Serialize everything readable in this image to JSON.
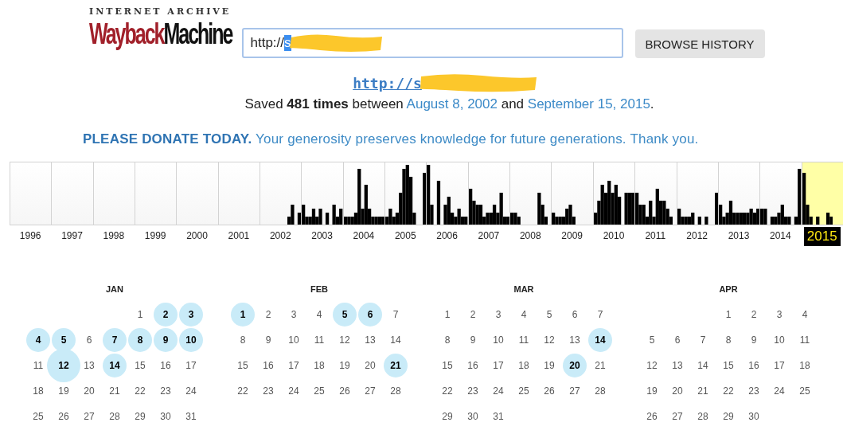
{
  "logo": {
    "top": "INTERNET ARCHIVE",
    "wayback": "Wayback",
    "machine": "Machine"
  },
  "search": {
    "value": "http://",
    "selected_text": "s"
  },
  "browse_button": "BROWSE HISTORY",
  "site_link": "http://s",
  "summary": [
    {
      "kind": "text",
      "text": "Saved **481 times** between "
    },
    {
      "kind": "link",
      "text": "August 8, 2002"
    },
    {
      "kind": "text",
      "text": " and "
    },
    {
      "kind": "link",
      "text": "September 15, 2015"
    },
    {
      "kind": "text",
      "text": "."
    }
  ],
  "donate": "**PLEASE DONATE TODAY.** Your generosity preserves knowledge for future generations. Thank you.",
  "years": [
    {
      "label": "1996",
      "selected": false
    },
    {
      "label": "1997",
      "selected": false
    },
    {
      "label": "1998",
      "selected": false
    },
    {
      "label": "1999",
      "selected": false
    },
    {
      "label": "2000",
      "selected": false
    },
    {
      "label": "2001",
      "selected": false
    },
    {
      "label": "2002",
      "selected": false
    },
    {
      "label": "2003",
      "selected": false
    },
    {
      "label": "2004",
      "selected": false
    },
    {
      "label": "2005",
      "selected": false
    },
    {
      "label": "2006",
      "selected": false
    },
    {
      "label": "2007",
      "selected": false
    },
    {
      "label": "2008",
      "selected": false
    },
    {
      "label": "2009",
      "selected": false
    },
    {
      "label": "2010",
      "selected": false
    },
    {
      "label": "2011",
      "selected": false
    },
    {
      "label": "2012",
      "selected": false
    },
    {
      "label": "2013",
      "selected": false
    },
    {
      "label": "2014",
      "selected": false
    },
    {
      "label": "2015",
      "selected": true
    }
  ],
  "months": [
    {
      "name": "JAN",
      "weeks": [
        {
          "days": [
            {
              "day": "1",
              "captured": false
            },
            {
              "day": "2",
              "captured": true
            },
            {
              "day": "3",
              "captured": true
            }
          ]
        },
        {
          "days": [
            {
              "day": "4",
              "captured": true
            },
            {
              "day": "5",
              "captured": true
            },
            {
              "day": "6",
              "captured": false
            },
            {
              "day": "7",
              "captured": true
            },
            {
              "day": "8",
              "captured": true
            },
            {
              "day": "9",
              "captured": true
            },
            {
              "day": "10",
              "captured": true
            }
          ]
        },
        {
          "days": [
            {
              "day": "11",
              "captured": false
            },
            {
              "day": "12",
              "captured": true,
              "large": true
            },
            {
              "day": "13",
              "captured": false
            },
            {
              "day": "14",
              "captured": true
            },
            {
              "day": "15",
              "captured": false
            },
            {
              "day": "16",
              "captured": false
            },
            {
              "day": "17",
              "captured": false
            }
          ]
        },
        {
          "days": [
            {
              "day": "18",
              "captured": false
            },
            {
              "day": "19",
              "captured": false
            },
            {
              "day": "20",
              "captured": false
            },
            {
              "day": "21",
              "captured": false
            },
            {
              "day": "22",
              "captured": false
            },
            {
              "day": "23",
              "captured": false
            },
            {
              "day": "24",
              "captured": false
            }
          ]
        },
        {
          "days": [
            {
              "day": "25",
              "captured": false
            },
            {
              "day": "26",
              "captured": false
            },
            {
              "day": "27",
              "captured": false
            },
            {
              "day": "28",
              "captured": false
            },
            {
              "day": "29",
              "captured": false
            },
            {
              "day": "30",
              "captured": false
            },
            {
              "day": "31",
              "captured": false
            }
          ]
        }
      ]
    },
    {
      "name": "FEB",
      "weeks": [
        {
          "days": [
            {
              "day": "1",
              "captured": true
            },
            {
              "day": "2",
              "captured": false
            },
            {
              "day": "3",
              "captured": false
            },
            {
              "day": "4",
              "captured": false
            },
            {
              "day": "5",
              "captured": true
            },
            {
              "day": "6",
              "captured": true
            },
            {
              "day": "7",
              "captured": false
            }
          ]
        },
        {
          "days": [
            {
              "day": "8",
              "captured": false
            },
            {
              "day": "9",
              "captured": false
            },
            {
              "day": "10",
              "captured": false
            },
            {
              "day": "11",
              "captured": false
            },
            {
              "day": "12",
              "captured": false
            },
            {
              "day": "13",
              "captured": false
            },
            {
              "day": "14",
              "captured": false
            }
          ]
        },
        {
          "days": [
            {
              "day": "15",
              "captured": false
            },
            {
              "day": "16",
              "captured": false
            },
            {
              "day": "17",
              "captured": false
            },
            {
              "day": "18",
              "captured": false
            },
            {
              "day": "19",
              "captured": false
            },
            {
              "day": "20",
              "captured": false
            },
            {
              "day": "21",
              "captured": true
            }
          ]
        },
        {
          "days": [
            {
              "day": "22",
              "captured": false
            },
            {
              "day": "23",
              "captured": false
            },
            {
              "day": "24",
              "captured": false
            },
            {
              "day": "25",
              "captured": false
            },
            {
              "day": "26",
              "captured": false
            },
            {
              "day": "27",
              "captured": false
            },
            {
              "day": "28",
              "captured": false
            }
          ]
        }
      ]
    },
    {
      "name": "MAR",
      "weeks": [
        {
          "days": [
            {
              "day": "1",
              "captured": false
            },
            {
              "day": "2",
              "captured": false
            },
            {
              "day": "3",
              "captured": false
            },
            {
              "day": "4",
              "captured": false
            },
            {
              "day": "5",
              "captured": false
            },
            {
              "day": "6",
              "captured": false
            },
            {
              "day": "7",
              "captured": false
            }
          ]
        },
        {
          "days": [
            {
              "day": "8",
              "captured": false
            },
            {
              "day": "9",
              "captured": false
            },
            {
              "day": "10",
              "captured": false
            },
            {
              "day": "11",
              "captured": false
            },
            {
              "day": "12",
              "captured": false
            },
            {
              "day": "13",
              "captured": false
            },
            {
              "day": "14",
              "captured": true
            }
          ]
        },
        {
          "days": [
            {
              "day": "15",
              "captured": false
            },
            {
              "day": "16",
              "captured": false
            },
            {
              "day": "17",
              "captured": false
            },
            {
              "day": "18",
              "captured": false
            },
            {
              "day": "19",
              "captured": false
            },
            {
              "day": "20",
              "captured": true
            },
            {
              "day": "21",
              "captured": false
            }
          ]
        },
        {
          "days": [
            {
              "day": "22",
              "captured": false
            },
            {
              "day": "23",
              "captured": false
            },
            {
              "day": "24",
              "captured": false
            },
            {
              "day": "25",
              "captured": false
            },
            {
              "day": "26",
              "captured": false
            },
            {
              "day": "27",
              "captured": false
            },
            {
              "day": "28",
              "captured": false
            }
          ]
        },
        {
          "days": [
            {
              "day": "29",
              "captured": false
            },
            {
              "day": "30",
              "captured": false
            },
            {
              "day": "31",
              "captured": false
            }
          ]
        }
      ]
    },
    {
      "name": "APR",
      "weeks": [
        {
          "days": [
            {
              "day": "1",
              "captured": false
            },
            {
              "day": "2",
              "captured": false
            },
            {
              "day": "3",
              "captured": false
            },
            {
              "day": "4",
              "captured": false
            }
          ]
        },
        {
          "days": [
            {
              "day": "5",
              "captured": false
            },
            {
              "day": "6",
              "captured": false
            },
            {
              "day": "7",
              "captured": false
            },
            {
              "day": "8",
              "captured": false
            },
            {
              "day": "9",
              "captured": false
            },
            {
              "day": "10",
              "captured": false
            },
            {
              "day": "11",
              "captured": false
            }
          ]
        },
        {
          "days": [
            {
              "day": "12",
              "captured": false
            },
            {
              "day": "13",
              "captured": false
            },
            {
              "day": "14",
              "captured": false
            },
            {
              "day": "15",
              "captured": false
            },
            {
              "day": "16",
              "captured": false
            },
            {
              "day": "17",
              "captured": false
            },
            {
              "day": "18",
              "captured": false
            }
          ]
        },
        {
          "days": [
            {
              "day": "19",
              "captured": false
            },
            {
              "day": "20",
              "captured": false
            },
            {
              "day": "21",
              "captured": false
            },
            {
              "day": "22",
              "captured": false
            },
            {
              "day": "23",
              "captured": false
            },
            {
              "day": "24",
              "captured": false
            },
            {
              "day": "25",
              "captured": false
            }
          ]
        },
        {
          "days": [
            {
              "day": "26",
              "captured": false
            },
            {
              "day": "27",
              "captured": false
            },
            {
              "day": "28",
              "captured": false
            },
            {
              "day": "29",
              "captured": false
            },
            {
              "day": "30",
              "captured": false
            }
          ]
        }
      ]
    }
  ]
}
